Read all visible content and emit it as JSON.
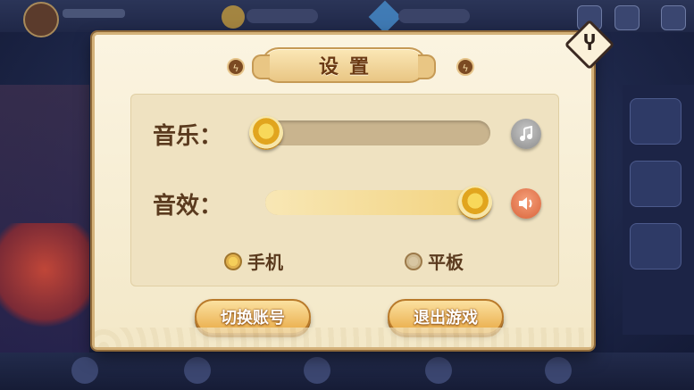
{
  "dialog": {
    "title": "设置",
    "close_glyph": "Ⴤ",
    "ornament_glyph": "ϟ",
    "music": {
      "label": "音乐：",
      "level": 0.0,
      "icon": "music-note-icon",
      "button_color": "#a9a9a9"
    },
    "sound": {
      "label": "音效：",
      "level": 1.0,
      "icon": "speaker-icon",
      "button_color": "#e67a4e"
    },
    "device_options": [
      {
        "label": "手机",
        "selected": true
      },
      {
        "label": "平板",
        "selected": false
      }
    ],
    "buttons": {
      "switch_account": "切换账号",
      "exit_game": "退出游戏"
    }
  },
  "colors": {
    "dialog_bg": "#f6ecd0",
    "accent_gold": "#e9aa46",
    "label_brown": "#5a3a1e"
  }
}
